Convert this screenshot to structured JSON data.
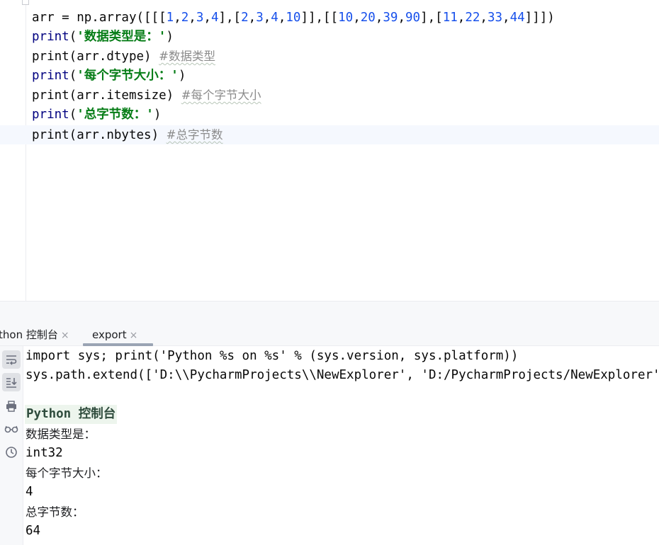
{
  "editor": {
    "lines": {
      "arr": {
        "a": "arr = np.array([[[",
        "n1": "1",
        "c1": ",",
        "n2": "2",
        "c2": ",",
        "n3": "3",
        "c3": ",",
        "n4": "4",
        "b": "],[",
        "n5": "2",
        "c4": ",",
        "n6": "3",
        "c5": ",",
        "n7": "4",
        "c6": ",",
        "n8": "10",
        "c": "]],[[",
        "n9": "10",
        "c7": ",",
        "n10": "20",
        "c8": ",",
        "n11": "39",
        "c9": ",",
        "n12": "90",
        "d": "],[",
        "n13": "11",
        "c10": ",",
        "n14": "22",
        "c11": ",",
        "n15": "33",
        "c12": ",",
        "n16": "44",
        "e": "]]])"
      },
      "l2": {
        "fn": "print",
        "open": "(",
        "str": "'数据类型是：'",
        "close": ")"
      },
      "l3": {
        "code": "print(arr.dtype) ",
        "comment": "#数据类型"
      },
      "l4": {
        "fn": "print",
        "open": "(",
        "str": "'每个字节大小：'",
        "close": ")"
      },
      "l5": {
        "code": "print(arr.itemsize) ",
        "comment": "#每个字节大小"
      },
      "l6": {
        "fn": "print",
        "open": "(",
        "str": "'总字节数：'",
        "close": ")"
      },
      "l7": {
        "code": "print(arr.nbytes) ",
        "comment": "#总字节数"
      }
    }
  },
  "tool_window": {
    "tabs": [
      {
        "label": "thon 控制台",
        "close": "×"
      },
      {
        "label": "export",
        "close": "×",
        "active": true
      }
    ],
    "toolbar_icons": [
      "soft-wrap-icon",
      "scroll-to-end-icon",
      "print-icon",
      "glasses-icon",
      "history-icon"
    ],
    "console": {
      "cmd1": "import sys; print('Python %s on %s' % (sys.version, sys.platform))",
      "cmd2": "sys.path.extend(['D:\\\\PycharmProjects\\\\NewExplorer', 'D:/PycharmProjects/NewExplorer'])",
      "banner": "Python 控制台",
      "out": [
        "数据类型是：",
        "int32",
        "每个字节大小：",
        "4",
        "总字节数：",
        "64"
      ]
    }
  },
  "colors": {
    "keyword": "#000080",
    "number": "#1750eb",
    "string": "#067d17",
    "comment": "#8c8c8c",
    "banner_bg": "#edf5ed"
  }
}
